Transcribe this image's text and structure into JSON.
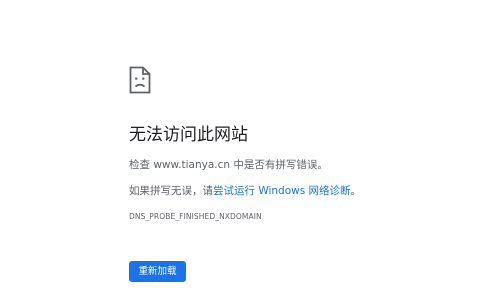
{
  "error": {
    "icon": "sad-page-icon",
    "title": "无法访问此网站",
    "detail_prefix": "检查 ",
    "url": "www.tianya.cn",
    "detail_suffix": " 中是否有拼写错误。",
    "suggest_prefix": "如果拼写无误，请",
    "suggest_link": "尝试运行 Windows 网络诊断",
    "suggest_suffix": "。",
    "code": "DNS_PROBE_FINISHED_NXDOMAIN",
    "reload_label": "重新加载"
  },
  "colors": {
    "accent": "#1a73e8",
    "title_text": "#202124",
    "secondary_text": "#5f6368",
    "background": "#ffffff"
  }
}
